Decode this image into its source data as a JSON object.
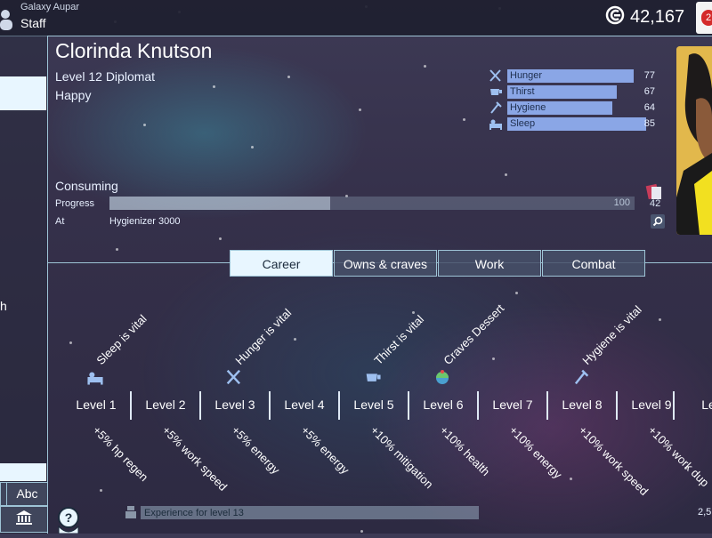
{
  "topbar": {
    "station": "Galaxy Aupar",
    "section": "Staff",
    "credits": "42,167",
    "notification_count": "2"
  },
  "left": {
    "partial_text": "h",
    "abc_label": "Abc"
  },
  "character": {
    "name": "Clorinda Knutson",
    "level_title": "Level 12 Diplomat",
    "mood": "Happy"
  },
  "needs": [
    {
      "label": "Hunger",
      "value": "77",
      "level": 0.77,
      "icon": "hunger-icon"
    },
    {
      "label": "Thirst",
      "value": "67",
      "level": 0.67,
      "icon": "thirst-icon"
    },
    {
      "label": "Hygiene",
      "value": "64",
      "level": 0.64,
      "icon": "hygiene-icon"
    },
    {
      "label": "Sleep",
      "value": "85",
      "level": 0.85,
      "icon": "sleep-icon"
    }
  ],
  "consuming": {
    "title": "Consuming",
    "progress_label": "Progress",
    "progress_max": "100",
    "progress_level": 0.42,
    "at_label": "At",
    "at_value": "Hygienizer 3000",
    "item_count": "42"
  },
  "tabs": [
    {
      "label": "Career",
      "active": true
    },
    {
      "label": "Owns & craves",
      "active": false
    },
    {
      "label": "Work",
      "active": false
    },
    {
      "label": "Combat",
      "active": false
    }
  ],
  "career": {
    "levels": [
      "Level 1",
      "Level 2",
      "Level 3",
      "Level 4",
      "Level 5",
      "Level 6",
      "Level 7",
      "Level 8",
      "Level 9",
      "Le"
    ],
    "traits": [
      {
        "label": "Sleep is vital",
        "icon": "sleep-icon"
      },
      {
        "label": "Hunger is vital",
        "icon": "hunger-icon"
      },
      {
        "label": "Thirst is vital",
        "icon": "thirst-icon"
      },
      {
        "label": "Craves Dessert",
        "icon": "dessert-icon"
      },
      {
        "label": "Hygiene is vital",
        "icon": "hygiene-icon"
      }
    ],
    "bonuses": [
      "+5% hp regen",
      "+5% work speed",
      "+5% energy",
      "+5% energy",
      "+10% mitigation",
      "+10% health",
      "+10% energy",
      "+10% work speed",
      "+10% work dup"
    ]
  },
  "xp": {
    "label": "Experience for level 13",
    "right_value": "2,5"
  },
  "colors": {
    "accent": "#9ec4d6",
    "need_bar": "#8aa6e6",
    "active_tab": "#e8f6ff",
    "badge": "#d42a2a"
  }
}
